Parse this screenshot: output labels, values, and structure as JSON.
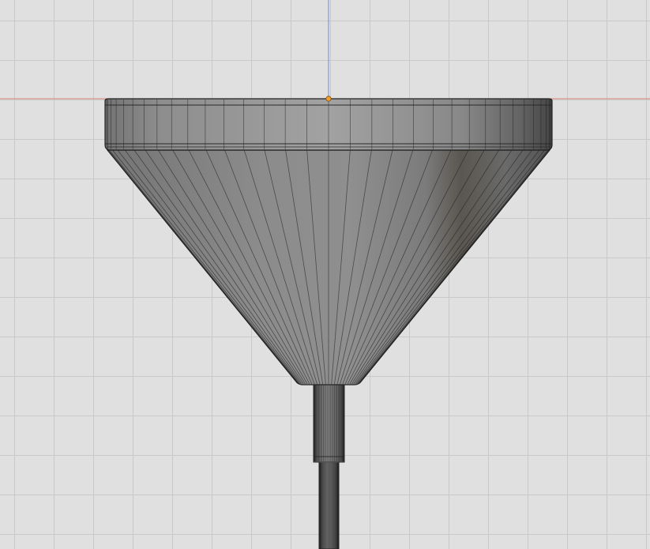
{
  "viewport": {
    "grid": "on",
    "background_color": "#e0e0e0",
    "grid_color": "#c9c9c9",
    "x_axis_color": "#d9826f",
    "z_axis_color": "#6f87d9",
    "origin_color": "#f0a030"
  },
  "model": {
    "object_type": "funnel",
    "mesh_color": "#8a8a8a",
    "edge_color": "#1e1e1e",
    "parts": [
      "rim",
      "cone",
      "neck",
      "spout"
    ],
    "view": "front-orthographic",
    "display": "solid-with-wireframe"
  }
}
